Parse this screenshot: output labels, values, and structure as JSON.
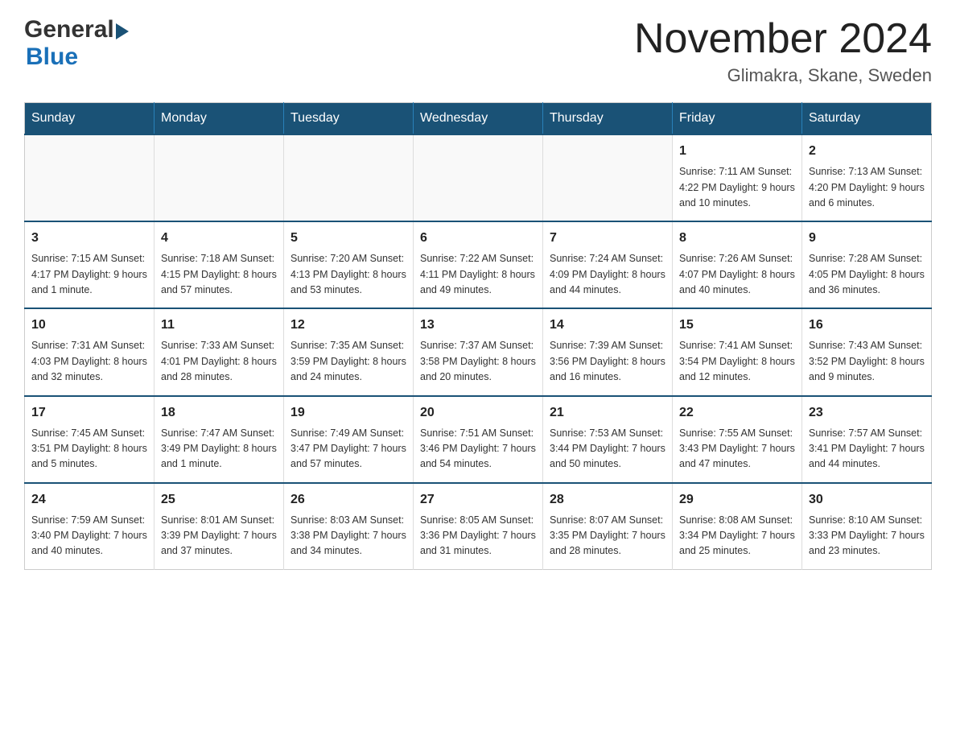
{
  "logo": {
    "general": "General",
    "blue": "Blue"
  },
  "title": {
    "month": "November 2024",
    "location": "Glimakra, Skane, Sweden"
  },
  "weekdays": [
    "Sunday",
    "Monday",
    "Tuesday",
    "Wednesday",
    "Thursday",
    "Friday",
    "Saturday"
  ],
  "weeks": [
    [
      {
        "day": "",
        "info": ""
      },
      {
        "day": "",
        "info": ""
      },
      {
        "day": "",
        "info": ""
      },
      {
        "day": "",
        "info": ""
      },
      {
        "day": "",
        "info": ""
      },
      {
        "day": "1",
        "info": "Sunrise: 7:11 AM\nSunset: 4:22 PM\nDaylight: 9 hours and 10 minutes."
      },
      {
        "day": "2",
        "info": "Sunrise: 7:13 AM\nSunset: 4:20 PM\nDaylight: 9 hours and 6 minutes."
      }
    ],
    [
      {
        "day": "3",
        "info": "Sunrise: 7:15 AM\nSunset: 4:17 PM\nDaylight: 9 hours and 1 minute."
      },
      {
        "day": "4",
        "info": "Sunrise: 7:18 AM\nSunset: 4:15 PM\nDaylight: 8 hours and 57 minutes."
      },
      {
        "day": "5",
        "info": "Sunrise: 7:20 AM\nSunset: 4:13 PM\nDaylight: 8 hours and 53 minutes."
      },
      {
        "day": "6",
        "info": "Sunrise: 7:22 AM\nSunset: 4:11 PM\nDaylight: 8 hours and 49 minutes."
      },
      {
        "day": "7",
        "info": "Sunrise: 7:24 AM\nSunset: 4:09 PM\nDaylight: 8 hours and 44 minutes."
      },
      {
        "day": "8",
        "info": "Sunrise: 7:26 AM\nSunset: 4:07 PM\nDaylight: 8 hours and 40 minutes."
      },
      {
        "day": "9",
        "info": "Sunrise: 7:28 AM\nSunset: 4:05 PM\nDaylight: 8 hours and 36 minutes."
      }
    ],
    [
      {
        "day": "10",
        "info": "Sunrise: 7:31 AM\nSunset: 4:03 PM\nDaylight: 8 hours and 32 minutes."
      },
      {
        "day": "11",
        "info": "Sunrise: 7:33 AM\nSunset: 4:01 PM\nDaylight: 8 hours and 28 minutes."
      },
      {
        "day": "12",
        "info": "Sunrise: 7:35 AM\nSunset: 3:59 PM\nDaylight: 8 hours and 24 minutes."
      },
      {
        "day": "13",
        "info": "Sunrise: 7:37 AM\nSunset: 3:58 PM\nDaylight: 8 hours and 20 minutes."
      },
      {
        "day": "14",
        "info": "Sunrise: 7:39 AM\nSunset: 3:56 PM\nDaylight: 8 hours and 16 minutes."
      },
      {
        "day": "15",
        "info": "Sunrise: 7:41 AM\nSunset: 3:54 PM\nDaylight: 8 hours and 12 minutes."
      },
      {
        "day": "16",
        "info": "Sunrise: 7:43 AM\nSunset: 3:52 PM\nDaylight: 8 hours and 9 minutes."
      }
    ],
    [
      {
        "day": "17",
        "info": "Sunrise: 7:45 AM\nSunset: 3:51 PM\nDaylight: 8 hours and 5 minutes."
      },
      {
        "day": "18",
        "info": "Sunrise: 7:47 AM\nSunset: 3:49 PM\nDaylight: 8 hours and 1 minute."
      },
      {
        "day": "19",
        "info": "Sunrise: 7:49 AM\nSunset: 3:47 PM\nDaylight: 7 hours and 57 minutes."
      },
      {
        "day": "20",
        "info": "Sunrise: 7:51 AM\nSunset: 3:46 PM\nDaylight: 7 hours and 54 minutes."
      },
      {
        "day": "21",
        "info": "Sunrise: 7:53 AM\nSunset: 3:44 PM\nDaylight: 7 hours and 50 minutes."
      },
      {
        "day": "22",
        "info": "Sunrise: 7:55 AM\nSunset: 3:43 PM\nDaylight: 7 hours and 47 minutes."
      },
      {
        "day": "23",
        "info": "Sunrise: 7:57 AM\nSunset: 3:41 PM\nDaylight: 7 hours and 44 minutes."
      }
    ],
    [
      {
        "day": "24",
        "info": "Sunrise: 7:59 AM\nSunset: 3:40 PM\nDaylight: 7 hours and 40 minutes."
      },
      {
        "day": "25",
        "info": "Sunrise: 8:01 AM\nSunset: 3:39 PM\nDaylight: 7 hours and 37 minutes."
      },
      {
        "day": "26",
        "info": "Sunrise: 8:03 AM\nSunset: 3:38 PM\nDaylight: 7 hours and 34 minutes."
      },
      {
        "day": "27",
        "info": "Sunrise: 8:05 AM\nSunset: 3:36 PM\nDaylight: 7 hours and 31 minutes."
      },
      {
        "day": "28",
        "info": "Sunrise: 8:07 AM\nSunset: 3:35 PM\nDaylight: 7 hours and 28 minutes."
      },
      {
        "day": "29",
        "info": "Sunrise: 8:08 AM\nSunset: 3:34 PM\nDaylight: 7 hours and 25 minutes."
      },
      {
        "day": "30",
        "info": "Sunrise: 8:10 AM\nSunset: 3:33 PM\nDaylight: 7 hours and 23 minutes."
      }
    ]
  ]
}
